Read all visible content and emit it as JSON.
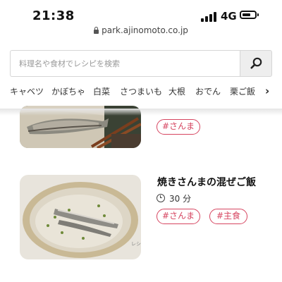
{
  "status_bar": {
    "time": "21:38",
    "network": "4G"
  },
  "browser": {
    "url": "park.ajinomoto.co.jp"
  },
  "search": {
    "placeholder": "料理名や食材でレシピを検索"
  },
  "categories": [
    "キャベツ",
    "かぼちゃ",
    "白菜",
    "さつまいも",
    "大根",
    "おでん",
    "栗ご飯"
  ],
  "recipes": [
    {
      "tags": [
        "#さんま"
      ]
    },
    {
      "title": "焼きさんまの混ぜご飯",
      "time": "30 分",
      "tags": [
        "#さんま",
        "#主食"
      ]
    }
  ],
  "colors": {
    "tag_accent": "#d64560",
    "search_button_bg": "#eeeeee"
  },
  "icons": [
    "lock-icon",
    "search-icon",
    "chevron-right-icon",
    "clock-icon"
  ]
}
